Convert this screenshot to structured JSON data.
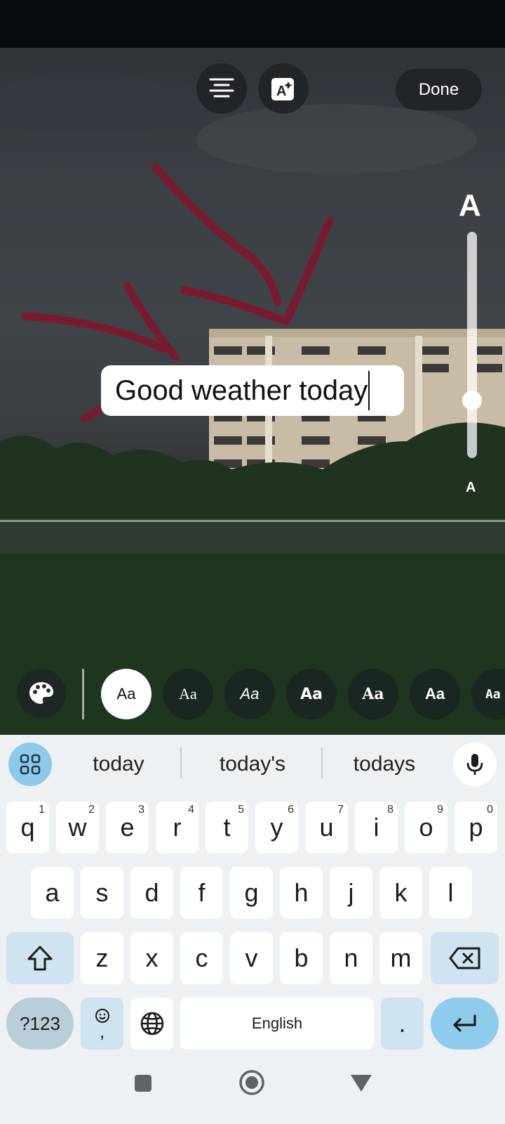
{
  "editor": {
    "done_label": "Done",
    "align_icon": "align-center-icon",
    "effects_icon": "text-effects-icon",
    "size_large_label": "A",
    "size_small_label": "A",
    "text_size_level": 0.27,
    "text": "Good weather today"
  },
  "font_styles": {
    "palette_icon": "palette-icon",
    "items": [
      {
        "label": "Aa",
        "selected": true
      },
      {
        "label": "Aa"
      },
      {
        "label": "Aa"
      },
      {
        "label": "Aa"
      },
      {
        "label": "Aa"
      },
      {
        "label": "Aa"
      },
      {
        "label": "Aa"
      }
    ]
  },
  "keyboard": {
    "suggestions": [
      "today",
      "today's",
      "todays"
    ],
    "row1": [
      {
        "key": "q",
        "hint": "1"
      },
      {
        "key": "w",
        "hint": "2"
      },
      {
        "key": "e",
        "hint": "3"
      },
      {
        "key": "r",
        "hint": "4"
      },
      {
        "key": "t",
        "hint": "5"
      },
      {
        "key": "y",
        "hint": "6"
      },
      {
        "key": "u",
        "hint": "7"
      },
      {
        "key": "i",
        "hint": "8"
      },
      {
        "key": "o",
        "hint": "9"
      },
      {
        "key": "p",
        "hint": "0"
      }
    ],
    "row2": [
      "a",
      "s",
      "d",
      "f",
      "g",
      "h",
      "j",
      "k",
      "l"
    ],
    "row3": [
      "z",
      "x",
      "c",
      "v",
      "b",
      "n",
      "m"
    ],
    "symbols_label": "?123",
    "emoji_comma_label": ",",
    "space_label": "English",
    "period_label": "."
  },
  "colors": {
    "arrow_stroke": "#7a1a2e",
    "keyboard_accent": "#8fcbeb",
    "modifier_key": "#cfe3f0"
  }
}
